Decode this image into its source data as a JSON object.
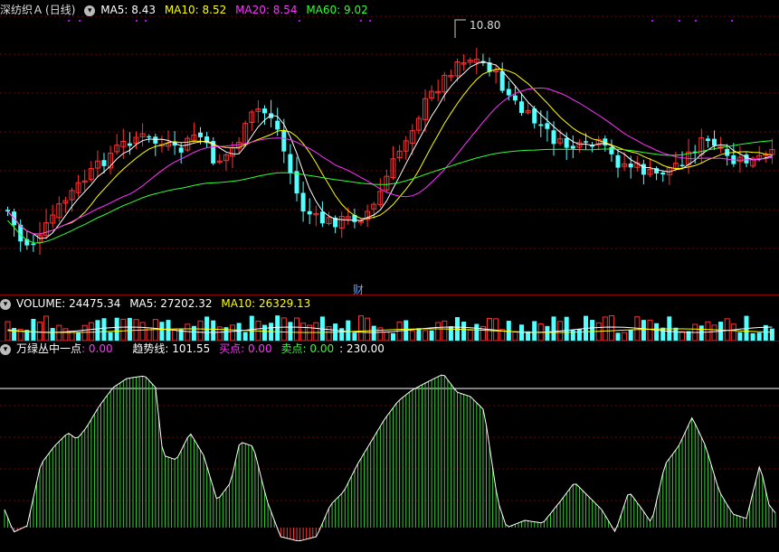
{
  "main": {
    "stock_name": "深纺织Ａ",
    "period": "(日线)",
    "menu_icon": "chevron-down-icon",
    "ma": [
      {
        "label": "MA5: 8.43",
        "color": "#ffffff"
      },
      {
        "label": "MA10: 8.52",
        "color": "#ffff00"
      },
      {
        "label": "MA20: 8.54",
        "color": "#ff33ff"
      },
      {
        "label": "MA60: 9.02",
        "color": "#33ff33"
      }
    ],
    "high_marker": "10.80",
    "event_marker": "财"
  },
  "volume": {
    "title": "VOLUME: 24475.34",
    "ma5": "MA5: 27202.32",
    "ma10": "MA10: 26329.13"
  },
  "indicator": {
    "name": "万绿丛中一点",
    "value": ": 0.00",
    "trend_label": "趋势线: 101.55",
    "buy_label": "买点: 0.00",
    "sell_label": "卖点: 0.00",
    "extra": ": 230.00"
  },
  "colors": {
    "up": "#ff3232",
    "down": "#54ffff",
    "background": "#000000",
    "grid": "#8b0000",
    "green_bar": "#33cc33",
    "red_bar": "#ff3232"
  }
}
